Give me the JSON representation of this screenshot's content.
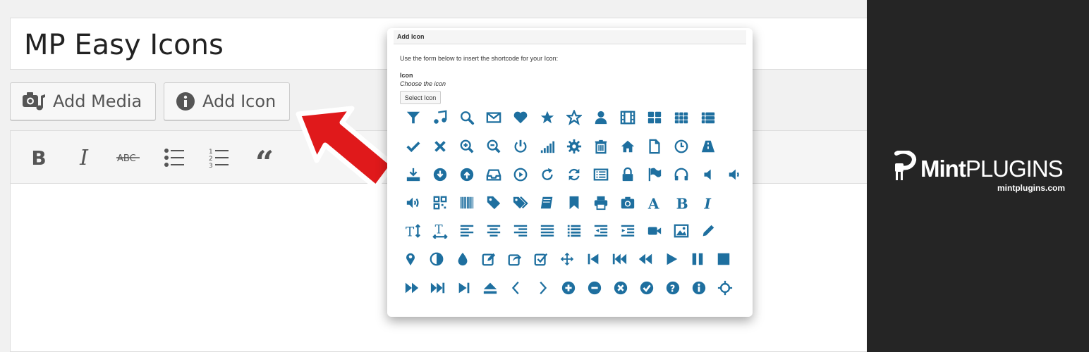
{
  "editor": {
    "post_title": "MP Easy Icons",
    "buttons": {
      "add_media": "Add Media",
      "add_icon": "Add Icon"
    },
    "toolbar_icons": [
      "bold-icon",
      "italic-icon",
      "strikethrough-icon",
      "bulleted-list-icon",
      "numbered-list-icon",
      "blockquote-icon"
    ]
  },
  "dialog": {
    "title": "Add Icon",
    "intro": "Use the form below to insert the shortcode for your Icon:",
    "field_label": "Icon",
    "field_help": "Choose the icon",
    "select_button": "Select Icon"
  },
  "icon_grid": [
    [
      "filter",
      "music",
      "search",
      "envelope",
      "heart",
      "star",
      "star-empty",
      "user",
      "film",
      "th-large",
      "th",
      "th-list"
    ],
    [
      "ok",
      "remove",
      "zoom-in",
      "zoom-out",
      "off",
      "signal",
      "cog",
      "trash",
      "home",
      "file",
      "time",
      "road"
    ],
    [
      "download-alt",
      "download",
      "upload",
      "inbox",
      "play-circle",
      "repeat",
      "refresh",
      "list-alt",
      "lock",
      "flag",
      "headphones",
      "volume-off",
      "volume-down"
    ],
    [
      "volume-up",
      "qrcode",
      "barcode",
      "tag",
      "tags",
      "book",
      "bookmark",
      "print",
      "camera",
      "font",
      "bold",
      "italic"
    ],
    [
      "text-height",
      "text-width",
      "align-left",
      "align-center",
      "align-right",
      "align-justify",
      "list",
      "indent-left",
      "indent-right",
      "facetime-video",
      "picture",
      "pencil"
    ],
    [
      "map-marker",
      "adjust",
      "tint",
      "edit",
      "share",
      "check",
      "move",
      "step-backward",
      "fast-backward",
      "backward",
      "play",
      "pause",
      "stop"
    ],
    [
      "forward",
      "fast-forward",
      "step-forward",
      "eject",
      "chevron-left",
      "chevron-right",
      "plus-sign",
      "minus-sign",
      "remove-sign",
      "ok-sign",
      "question-sign",
      "info-sign",
      "screenshot"
    ]
  ],
  "brand": {
    "name_bold": "Mint",
    "name_rest": "PLUGINS",
    "url": "mintplugins.com"
  },
  "colors": {
    "icon_blue": "#1e6f9f",
    "arrow_red": "#e0191b",
    "brand_bg": "#252525"
  }
}
